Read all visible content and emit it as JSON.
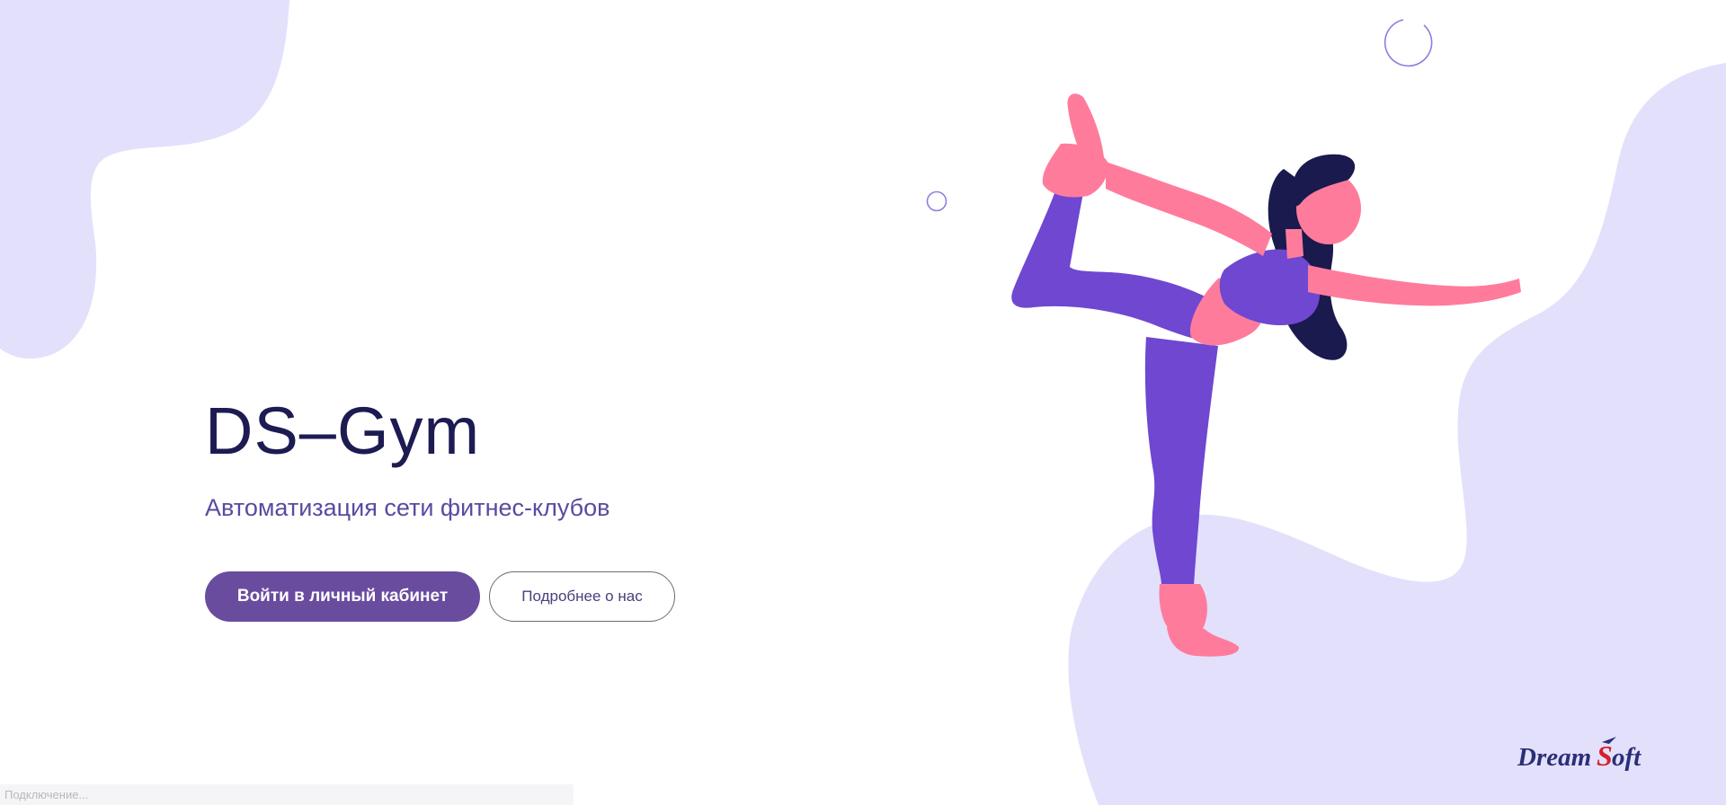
{
  "hero": {
    "title": "DS–Gym",
    "subtitle": "Автоматизация сети фитнес-клубов"
  },
  "actions": {
    "login_label": "Войти в личный кабинет",
    "about_label": "Подробнее о нас"
  },
  "branding": {
    "logo_text_left": "Dream",
    "logo_text_right": "oft",
    "logo_letter": "S"
  },
  "status": {
    "text": "Подключение..."
  },
  "colors": {
    "blob": "#e3e0fc",
    "title": "#1c1b52",
    "subtitle": "#5a4aa0",
    "primary_button": "#6a4c9f",
    "pink": "#ff7b9c",
    "purple": "#6f47d1",
    "hair": "#1a1a4e",
    "logo_navy": "#2a2f78",
    "logo_red": "#d6202a"
  },
  "icons": {
    "illustration": "yoga-woman-illustration",
    "logo": "dreamsoft-logo"
  }
}
